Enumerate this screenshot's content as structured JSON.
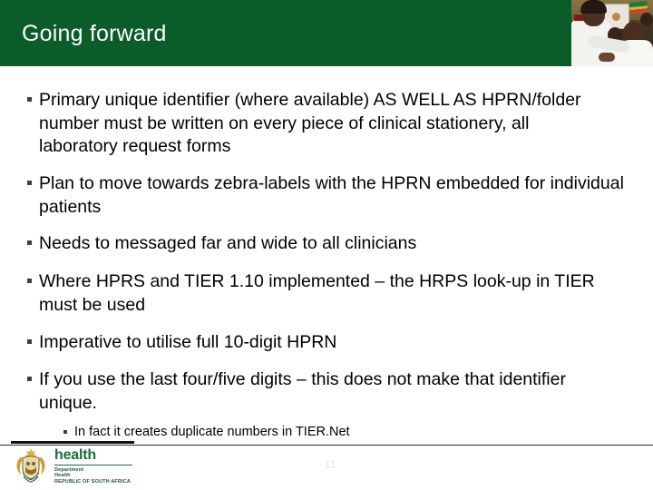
{
  "slide": {
    "title": "Going forward",
    "header_photo_alt": "nurse-with-children-photo",
    "accent_green": "#0a5c29",
    "bullet_marker": "square-bullet",
    "page_number": "11"
  },
  "bullets": [
    {
      "text": "Primary unique identifier (where available) AS WELL AS HPRN/folder number must be written on every piece of clinical stationery, all laboratory request forms"
    },
    {
      "text": "Plan to move towards zebra-labels with the HPRN embedded for individual patients"
    },
    {
      "text": "Needs to messaged far and wide to all clinicians"
    },
    {
      "text": "Where HPRS and TIER 1.10 implemented – the HRPS look-up in TIER must be used"
    },
    {
      "text": "Imperative to utilise full 10-digit HPRN"
    },
    {
      "text": "If you use the last four/five digits – this does not make that identifier unique."
    }
  ],
  "subbullets": [
    {
      "text": "In fact it creates duplicate numbers in TIER.Net"
    }
  ],
  "footer": {
    "logo": {
      "wordmark": "health",
      "line1": "Department",
      "line2": "Health",
      "line3": "REPUBLIC OF SOUTH AFRICA",
      "crest_name": "south-africa-coat-of-arms",
      "green": "#1d6b3a"
    }
  }
}
